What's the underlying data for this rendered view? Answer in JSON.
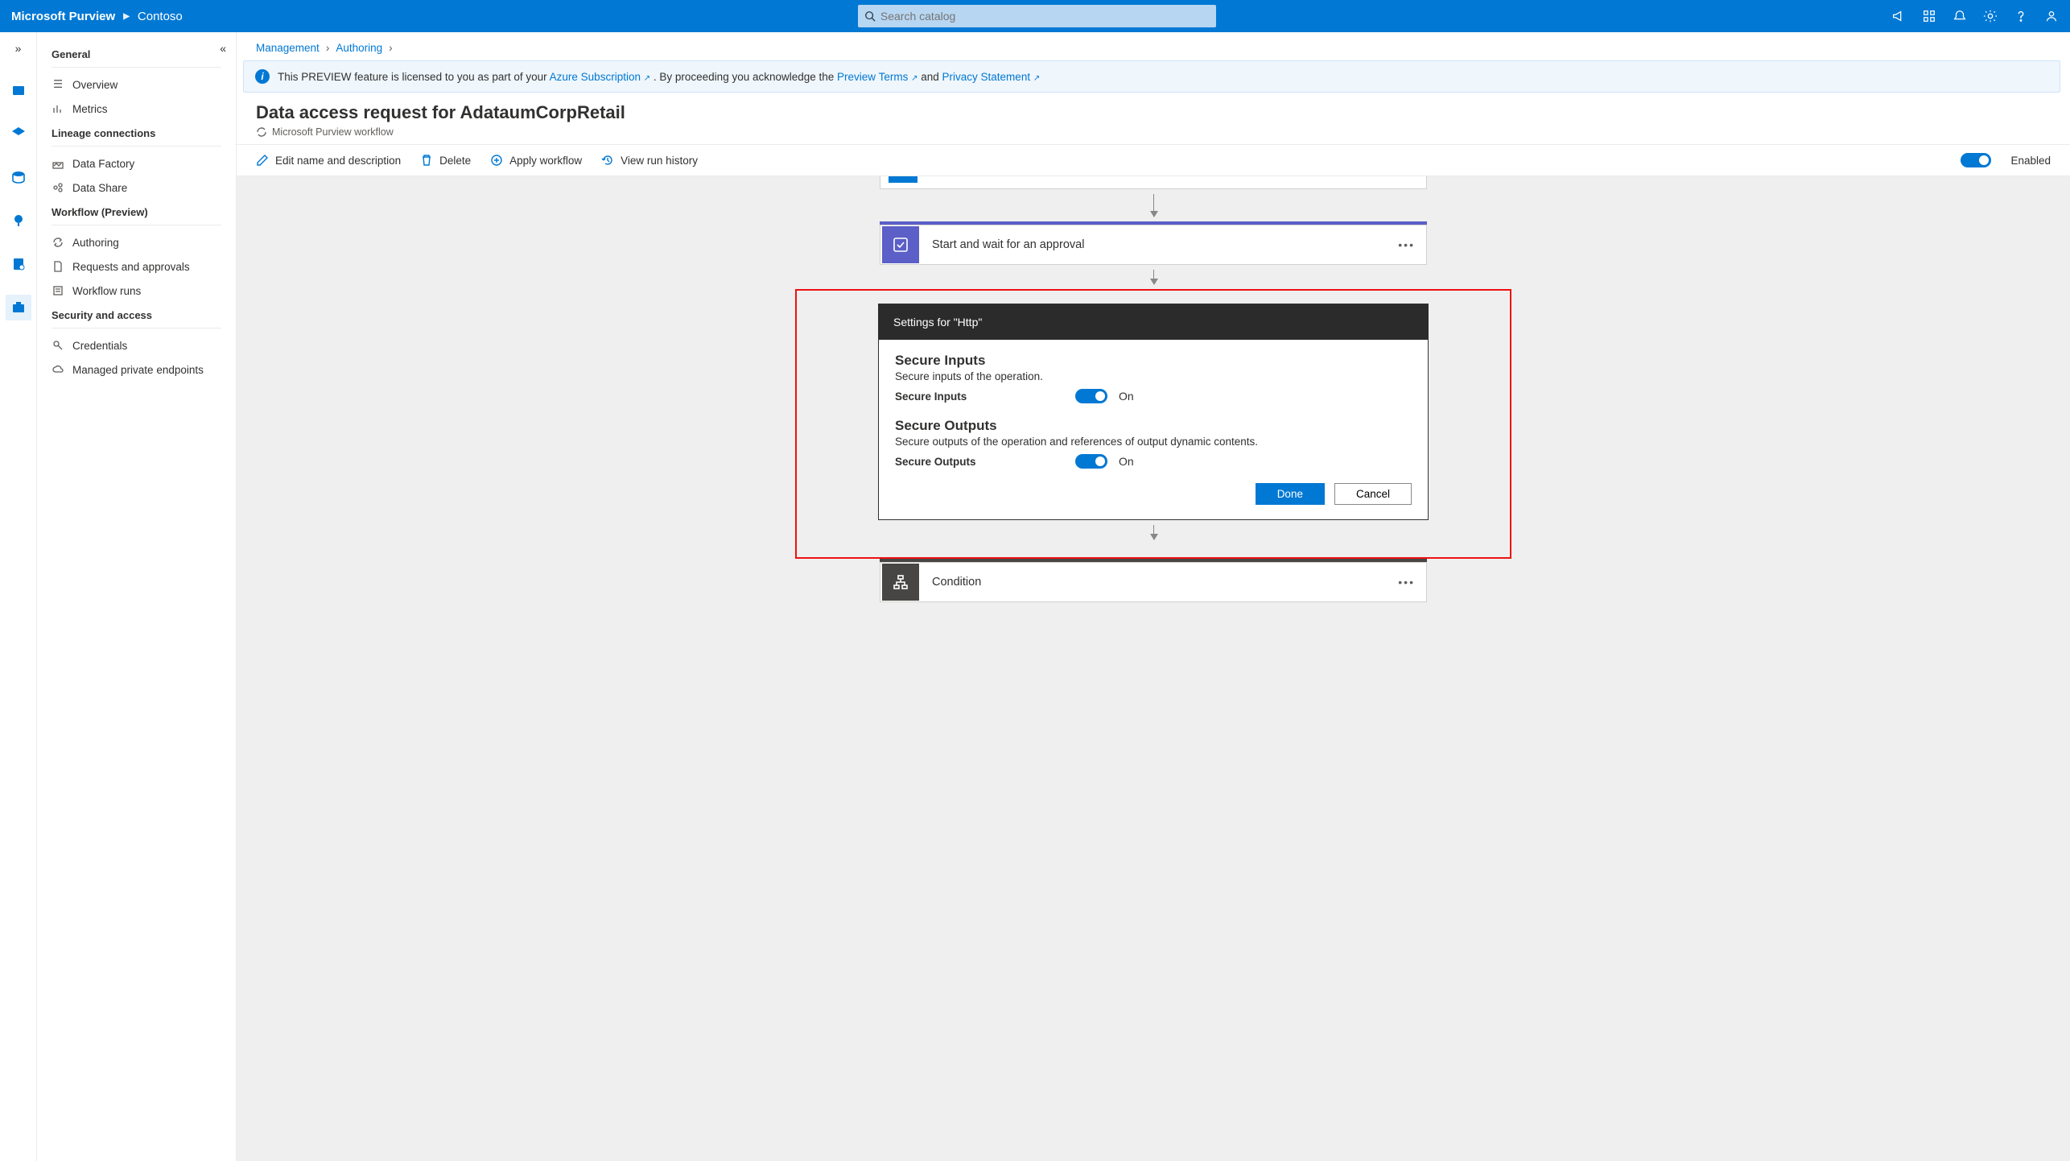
{
  "header": {
    "brand": "Microsoft Purview",
    "account": "Contoso",
    "search_placeholder": "Search catalog"
  },
  "sidebar": {
    "groups": [
      {
        "title": "General",
        "items": [
          "Overview",
          "Metrics"
        ]
      },
      {
        "title": "Lineage connections",
        "items": [
          "Data Factory",
          "Data Share"
        ]
      },
      {
        "title": "Workflow (Preview)",
        "items": [
          "Authoring",
          "Requests and approvals",
          "Workflow runs"
        ]
      },
      {
        "title": "Security and access",
        "items": [
          "Credentials",
          "Managed private endpoints"
        ]
      }
    ]
  },
  "breadcrumb": {
    "a": "Management",
    "b": "Authoring"
  },
  "banner": {
    "prefix": "This PREVIEW feature is licensed to you as part of your ",
    "link1": "Azure Subscription",
    "mid": ". By proceeding you acknowledge the ",
    "link2": "Preview Terms",
    "and": " and ",
    "link3": "Privacy Statement"
  },
  "page": {
    "title": "Data access request for AdataumCorpRetail",
    "subtitle": "Microsoft Purview workflow"
  },
  "commands": {
    "edit": "Edit name and description",
    "delete": "Delete",
    "apply": "Apply workflow",
    "history": "View run history",
    "enabled_label": "Enabled"
  },
  "flow": {
    "approval_title": "Start and wait for an approval",
    "condition_title": "Condition"
  },
  "settings": {
    "header": "Settings for \"Http\"",
    "inputs_title": "Secure Inputs",
    "inputs_desc": "Secure inputs of the operation.",
    "inputs_label": "Secure Inputs",
    "inputs_state": "On",
    "outputs_title": "Secure Outputs",
    "outputs_desc": "Secure outputs of the operation and references of output dynamic contents.",
    "outputs_label": "Secure Outputs",
    "outputs_state": "On",
    "done": "Done",
    "cancel": "Cancel"
  }
}
